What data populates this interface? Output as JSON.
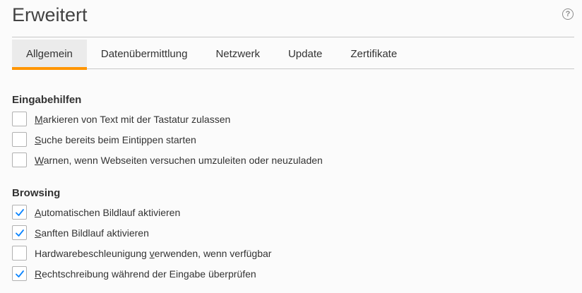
{
  "page": {
    "title": "Erweitert",
    "help_icon": "question-mark-icon"
  },
  "tabs": [
    {
      "label": "Allgemein",
      "selected": true
    },
    {
      "label": "Datenübermittlung",
      "selected": false
    },
    {
      "label": "Netzwerk",
      "selected": false
    },
    {
      "label": "Update",
      "selected": false
    },
    {
      "label": "Zertifikate",
      "selected": false
    }
  ],
  "accessibility": {
    "heading": "Eingabehilfen",
    "options": [
      {
        "key": "M",
        "rest": "arkieren von Text mit der Tastatur zulassen",
        "checked": false
      },
      {
        "key": "S",
        "rest": "uche bereits beim Eintippen starten",
        "checked": false
      },
      {
        "key": "W",
        "rest": "arnen, wenn Webseiten versuchen umzuleiten oder neuzuladen",
        "checked": false
      }
    ]
  },
  "browsing": {
    "heading": "Browsing",
    "options": [
      {
        "pre": "",
        "key": "A",
        "rest": "utomatischen Bildlauf aktivieren",
        "checked": true
      },
      {
        "pre": "",
        "key": "S",
        "rest": "anften Bildlauf aktivieren",
        "checked": true
      },
      {
        "pre": "Hardwarebeschleunigung ",
        "key": "v",
        "rest": "erwenden, wenn verfügbar",
        "checked": false
      },
      {
        "pre": "",
        "key": "R",
        "rest": "echtschreibung während der Eingabe überprüfen",
        "checked": true
      }
    ]
  },
  "colors": {
    "accent": "#ff9500",
    "check": "#0a84ff",
    "tab_selected_bg": "#ebebeb"
  }
}
